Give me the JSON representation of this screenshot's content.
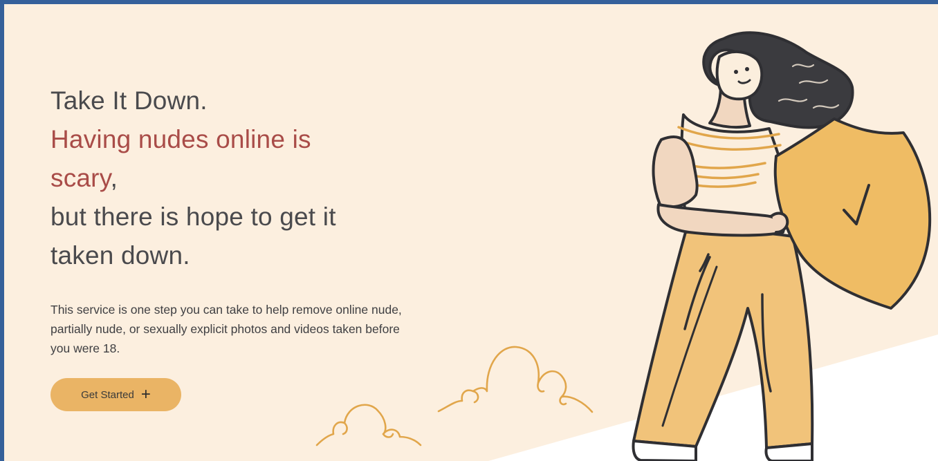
{
  "hero": {
    "title_line1": "Take It Down.",
    "title_line2": "Having nudes online is",
    "title_line3_accent": "scary",
    "title_line3_rest": ",",
    "title_line4": "but there is hope to get it",
    "title_line5": "taken down.",
    "description": "This service is one step you can take to help remove online nude, partially nude, or sexually explicit photos and videos taken before you were 18."
  },
  "cta": {
    "label": "Get Started",
    "icon": "plus-icon"
  },
  "illustration": {
    "subject": "woman-holding-shield-illustration",
    "shield_icon": "checkmark-shield-icon",
    "decor": [
      "cloud-doodle-icon",
      "cloud-doodle-icon"
    ]
  },
  "colors": {
    "border": "#35609a",
    "background": "#fcefdf",
    "accent_text": "#a94c48",
    "body_text": "#4a4a4d",
    "button": "#eab465",
    "shield": "#efbc64",
    "pants": "#f1c37a"
  }
}
